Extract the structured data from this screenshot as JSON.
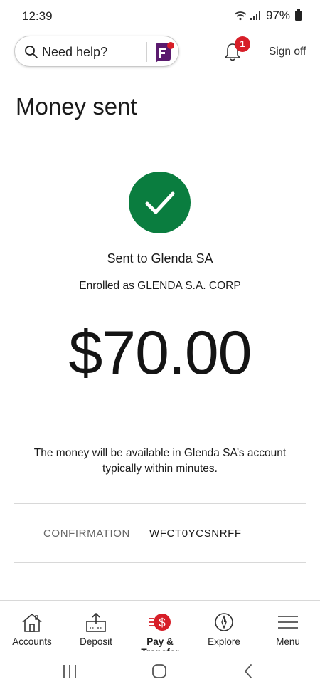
{
  "status_bar": {
    "time": "12:39",
    "battery": "97%"
  },
  "header": {
    "search_placeholder": "Need help?",
    "notification_count": "1",
    "sign_off": "Sign off"
  },
  "page": {
    "title": "Money sent"
  },
  "confirmation": {
    "sent_to": "Sent to Glenda SA",
    "enrolled_as": "Enrolled as GLENDA S.A. CORP",
    "amount": "$70.00",
    "availability": "The money will be available in Glenda SA’s account typically within minutes.",
    "confirmation_label": "CONFIRMATION",
    "confirmation_number": "WFCT0YCSNRFF"
  },
  "bottom_nav": {
    "items": [
      {
        "label": "Accounts",
        "icon": "house-icon",
        "active": false
      },
      {
        "label": "Deposit",
        "icon": "deposit-icon",
        "active": false
      },
      {
        "label": "Pay & Transfer",
        "icon": "pay-transfer-icon",
        "active": true
      },
      {
        "label": "Explore",
        "icon": "compass-icon",
        "active": false
      },
      {
        "label": "Menu",
        "icon": "hamburger-menu-icon",
        "active": false
      }
    ]
  },
  "colors": {
    "success_green": "#0a7d3f",
    "brand_red": "#d71e28",
    "fargo_purple": "#5a1a6e"
  }
}
